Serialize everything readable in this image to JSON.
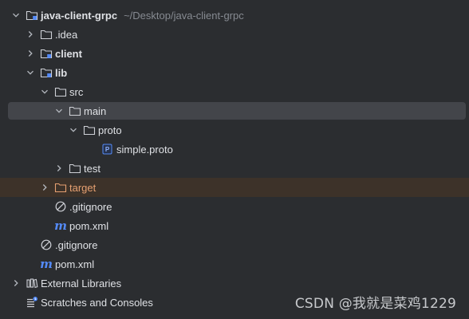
{
  "tree": {
    "root": {
      "label": "java-client-grpc",
      "path": "~/Desktop/java-client-grpc",
      "icon": "module-folder-icon",
      "expanded": true
    },
    "items": {
      "idea": {
        "label": ".idea",
        "icon": "folder-icon",
        "expanded": false
      },
      "client": {
        "label": "client",
        "icon": "module-folder-icon",
        "expanded": false
      },
      "lib": {
        "label": "lib",
        "icon": "module-folder-icon",
        "expanded": true
      },
      "src": {
        "label": "src",
        "icon": "folder-icon",
        "expanded": true
      },
      "main": {
        "label": "main",
        "icon": "folder-icon",
        "expanded": true,
        "selected": true
      },
      "proto": {
        "label": "proto",
        "icon": "folder-icon",
        "expanded": true
      },
      "simple_proto": {
        "label": "simple.proto",
        "icon": "proto-file-icon"
      },
      "test": {
        "label": "test",
        "icon": "folder-icon",
        "expanded": false
      },
      "target": {
        "label": "target",
        "icon": "excluded-folder-icon",
        "expanded": false
      },
      "lib_gitignore": {
        "label": ".gitignore",
        "icon": "gitignore-icon"
      },
      "lib_pom": {
        "label": "pom.xml",
        "icon": "maven-icon"
      },
      "root_gitignore": {
        "label": ".gitignore",
        "icon": "gitignore-icon"
      },
      "root_pom": {
        "label": "pom.xml",
        "icon": "maven-icon"
      },
      "external_libraries": {
        "label": "External Libraries",
        "icon": "library-icon",
        "expanded": false
      },
      "scratches": {
        "label": "Scratches and Consoles",
        "icon": "scratches-icon"
      }
    }
  },
  "watermark": "CSDN @我就是菜鸡1229",
  "colors": {
    "background": "#2b2d30",
    "selection": "#43454a",
    "excluded_row": "#3d3229",
    "excluded_label": "#e6a071",
    "proto_icon": "#548af7",
    "maven_icon": "#548af7"
  }
}
